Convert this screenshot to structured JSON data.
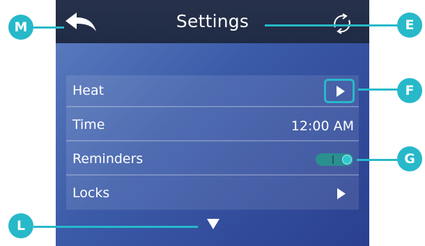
{
  "header": {
    "title": "Settings"
  },
  "menu": {
    "items": [
      {
        "label": "Heat",
        "value": ""
      },
      {
        "label": "Time",
        "value": "12:00 AM"
      },
      {
        "label": "Reminders",
        "value": ""
      },
      {
        "label": "Locks",
        "value": ""
      }
    ],
    "reminders_toggle_on": true
  },
  "callouts": {
    "M": "M",
    "E": "E",
    "F": "F",
    "G": "G",
    "L": "L"
  },
  "icons": {
    "back": "back-arrow-icon",
    "refresh": "refresh-icon",
    "heat_next": "play-right-icon",
    "locks_next": "play-right-icon",
    "scroll_down": "triangle-down-icon"
  },
  "colors": {
    "accent": "#27b9c9",
    "header": "#222c46",
    "background_start": "#5e7fc1",
    "background_end": "#2a3f8f",
    "toggle": "#2b8f90"
  }
}
